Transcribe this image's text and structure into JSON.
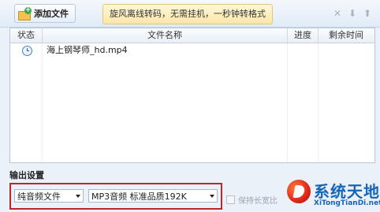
{
  "toolbar": {
    "add_files_label": "添加文件",
    "promo_text": "旋风离线转码，无需挂机，一秒钟转格式",
    "icons": [
      "close-icon",
      "arrow-down-icon",
      "arrow-up-icon"
    ],
    "icon_glyphs": [
      "✕",
      "⬇",
      "⬆"
    ]
  },
  "file_list": {
    "columns": [
      "状态",
      "文件名称",
      "进度",
      "剩余时间"
    ],
    "rows": [
      {
        "status_icon": "clock-icon",
        "name": "海上钢琴师_hd.mp4",
        "progress": "",
        "remaining": ""
      }
    ]
  },
  "output": {
    "label": "输出设置",
    "format_select": "纯音频文件",
    "quality_select": "MP3音频 标准品质192K",
    "keep_ratio_label": "保持长宽比",
    "keep_ratio_checked": false
  },
  "watermark": {
    "name": "系统天地",
    "url": "XiTongTianDi.net"
  },
  "colors": {
    "highlight_border": "#c0242c",
    "watermark_blue": "#1565b8"
  }
}
